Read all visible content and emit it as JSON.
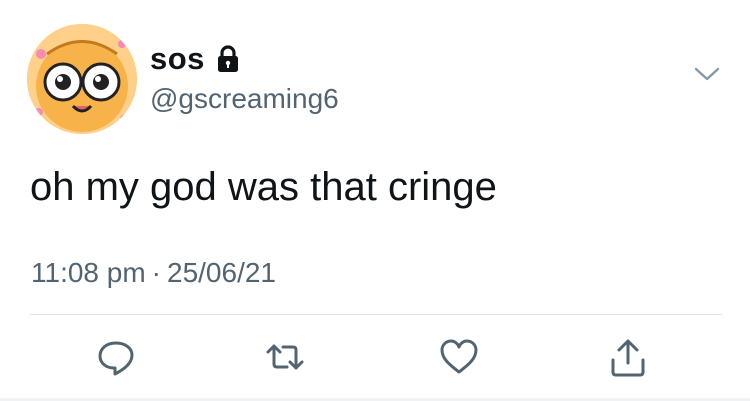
{
  "tweet": {
    "display_name": "sos",
    "handle": "@gscreaming6",
    "text": "oh my god was that cringe",
    "time": "11:08 pm",
    "date": "25/06/21",
    "separator": "·"
  },
  "icons": {
    "protected": "lock-icon",
    "more": "chevron-down-icon",
    "reply": "speech-bubble-icon",
    "retweet": "retweet-icon",
    "like": "heart-icon",
    "share": "share-icon"
  },
  "colors": {
    "text": "#0f1419",
    "secondary": "#536471",
    "icon": "#536471",
    "divider": "#dfe3e6"
  }
}
